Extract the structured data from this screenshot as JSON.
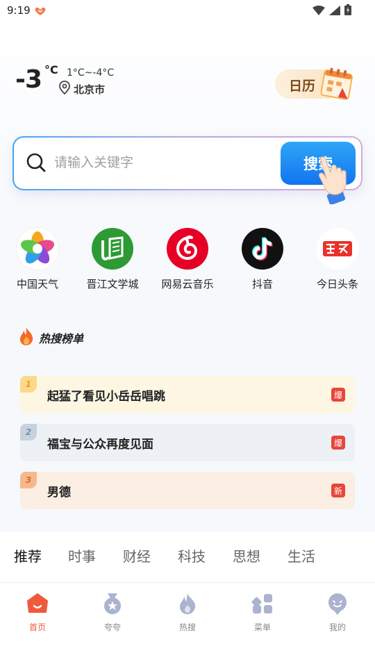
{
  "status": {
    "time": "9:19"
  },
  "weather": {
    "temp": "-3",
    "unit": "°C",
    "range": "1°C~-4°C",
    "location": "北京市"
  },
  "calendar": {
    "label": "日历"
  },
  "search": {
    "placeholder": "请输入关键字",
    "button_label": "搜索"
  },
  "apps": [
    {
      "label": "中国天气",
      "icon": "china-weather-icon"
    },
    {
      "label": "晋江文学城",
      "icon": "jinjiang-icon"
    },
    {
      "label": "网易云音乐",
      "icon": "netease-music-icon"
    },
    {
      "label": "抖音",
      "icon": "douyin-icon"
    },
    {
      "label": "今日头条",
      "icon": "toutiao-icon"
    }
  ],
  "hot": {
    "title": "热搜榜单",
    "items": [
      {
        "rank": "1",
        "text": "起猛了看见小岳岳唱跳",
        "badge": "爆"
      },
      {
        "rank": "2",
        "text": "福宝与公众再度见面",
        "badge": "爆"
      },
      {
        "rank": "3",
        "text": "男德",
        "badge": "新"
      }
    ]
  },
  "tabs": [
    "推荐",
    "时事",
    "财经",
    "科技",
    "思想",
    "生活"
  ],
  "nav": [
    {
      "label": "首页",
      "icon": "home-icon"
    },
    {
      "label": "夸夸",
      "icon": "medal-icon"
    },
    {
      "label": "热搜",
      "icon": "flame-icon"
    },
    {
      "label": "菜单",
      "icon": "menu-grid-icon"
    },
    {
      "label": "我的",
      "icon": "profile-icon"
    }
  ],
  "colors": {
    "accent": "#1174f0",
    "hot_red": "#e8453c",
    "nav_active": "#f05a3c"
  }
}
